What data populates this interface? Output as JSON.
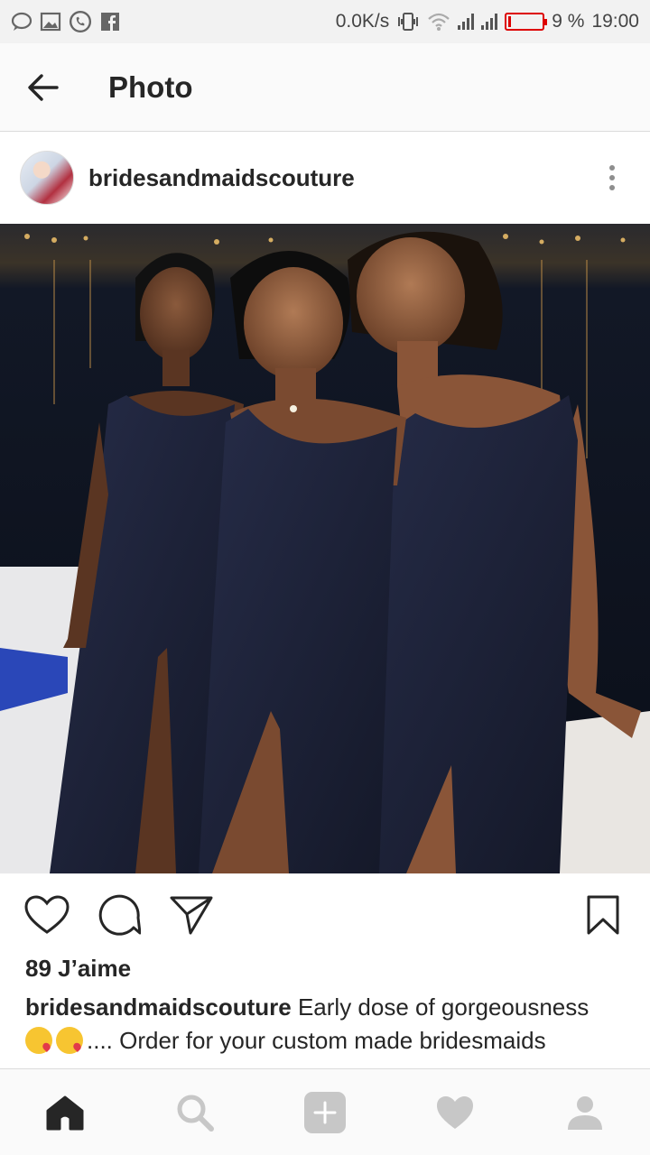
{
  "status_bar": {
    "network_speed": "0.0K/s",
    "battery_percent": "9 %",
    "battery_level": 0.09,
    "time": "19:00",
    "left_icons": [
      "message-icon",
      "gallery-icon",
      "whatsapp-icon",
      "facebook-icon"
    ],
    "battery_color": "#dd0000"
  },
  "header": {
    "title": "Photo",
    "back_icon": "arrow-left-icon"
  },
  "post": {
    "username": "bridesandmaidscouture",
    "likes": "89 J’aime",
    "caption_user": "bridesandmaidscouture",
    "caption_text_1": " Early dose of gorgeousness",
    "caption_text_2": ".... Order for your custom made bridesmaids",
    "caption_emojis": [
      "kissing-face-emoji",
      "kissing-face-emoji"
    ]
  },
  "actions": [
    "heart-icon",
    "comment-icon",
    "share-icon",
    "bookmark-icon"
  ],
  "bottom_nav": [
    "home-icon",
    "search-icon",
    "add-icon",
    "activity-heart-icon",
    "profile-icon"
  ],
  "colors": {
    "text": "#262626",
    "muted_icon": "#c7c7c7",
    "dress_navy": "#1c2138"
  }
}
